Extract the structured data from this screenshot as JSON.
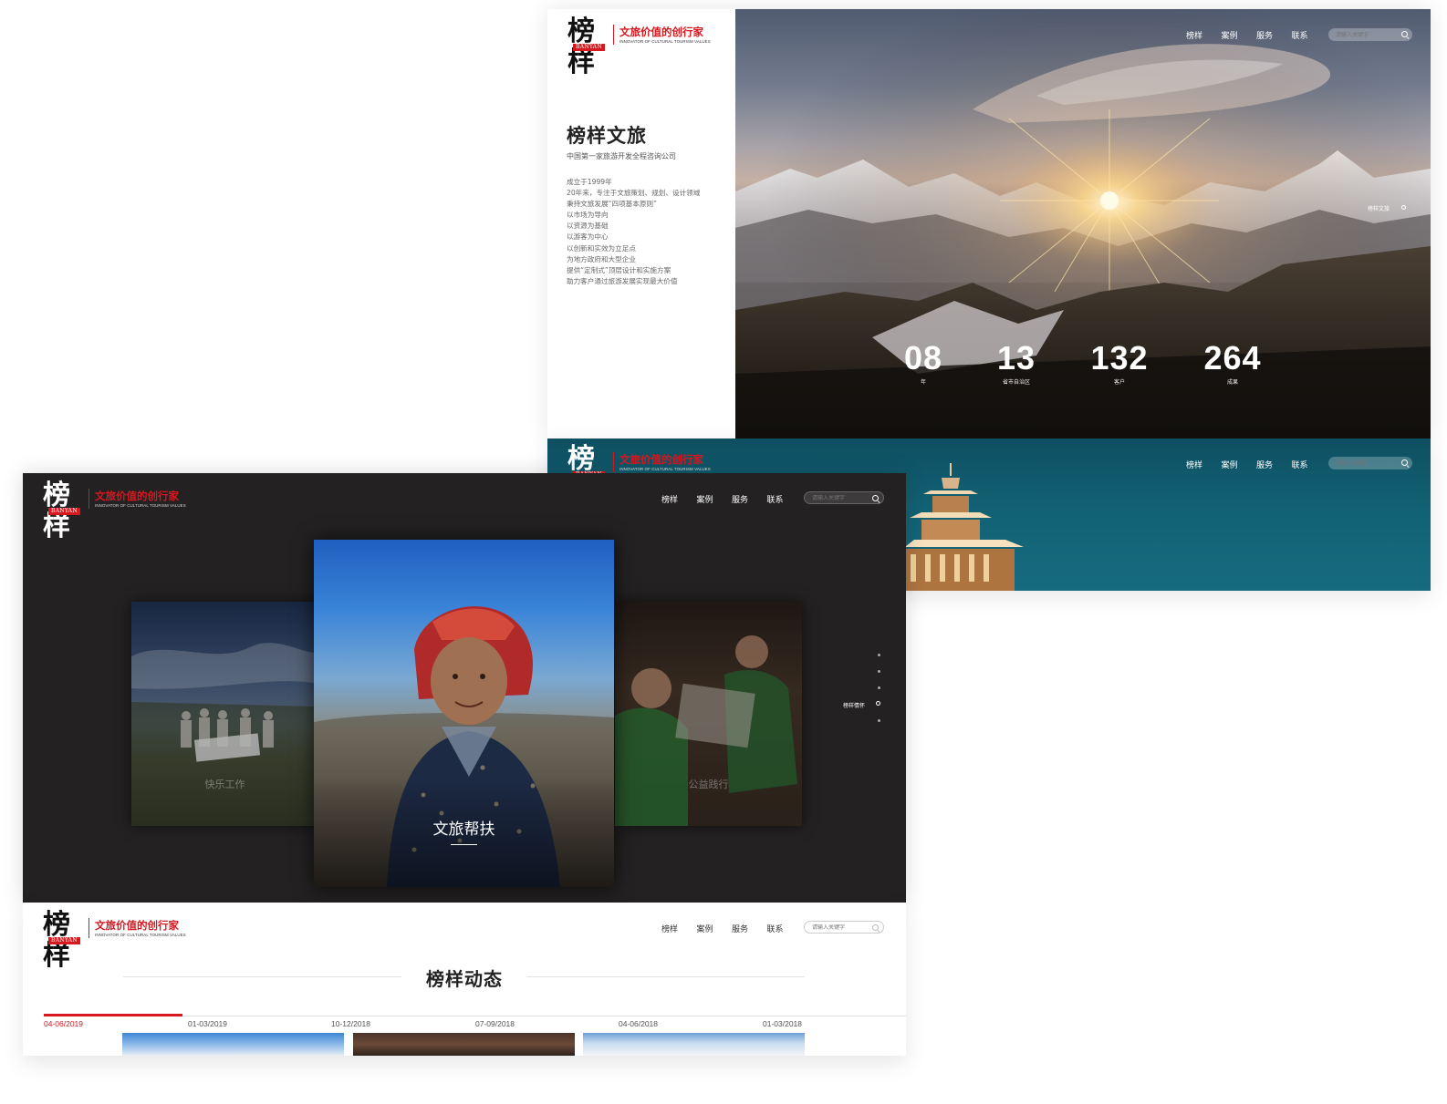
{
  "brand": {
    "logo_chars": "榜样",
    "logo_latin": "BANYAN",
    "slogan": "文旅价值的创行家",
    "slogan_sub": "INNOVATOR OF CULTURAL TOURISM VALUES"
  },
  "nav": {
    "items": [
      "榜样",
      "案例",
      "服务",
      "联系"
    ]
  },
  "search": {
    "placeholder": "请输入关键字"
  },
  "intro": {
    "title": "榜样文旅",
    "subtitle": "中国第一家旅游开发全程咨询公司",
    "lines": [
      "成立于1999年",
      "20年来，专注于文旅策划、规划、设计领域",
      "秉持文旅发展“四项基本原则”",
      "以市场为导向",
      "以资源为基础",
      "以游客为中心",
      "以创新和实效为立足点",
      "为地方政府和大型企业",
      "提供“定制式”顶层设计和实施方案",
      "助力客户通过旅游发展实现最大价值"
    ],
    "side_label": "榜样文旅",
    "stats": [
      {
        "value": "08",
        "label": "年"
      },
      {
        "value": "13",
        "label": "省市自治区"
      },
      {
        "value": "132",
        "label": "客户"
      },
      {
        "value": "264",
        "label": "成果"
      }
    ]
  },
  "charity": {
    "side_label": "榜样情怀",
    "cards": [
      {
        "caption": "快乐工作"
      },
      {
        "caption": "文旅帮扶"
      },
      {
        "caption": "公益践行"
      }
    ]
  },
  "news": {
    "title": "榜样动态",
    "dates": [
      "04-06/2019",
      "01-03/2019",
      "10-12/2018",
      "07-09/2018",
      "04-06/2018",
      "01-03/2018"
    ],
    "active_index": 0
  },
  "colors": {
    "brand_red": "#d7181f",
    "dark_bg": "#232121",
    "teal_bg": "#126174"
  }
}
